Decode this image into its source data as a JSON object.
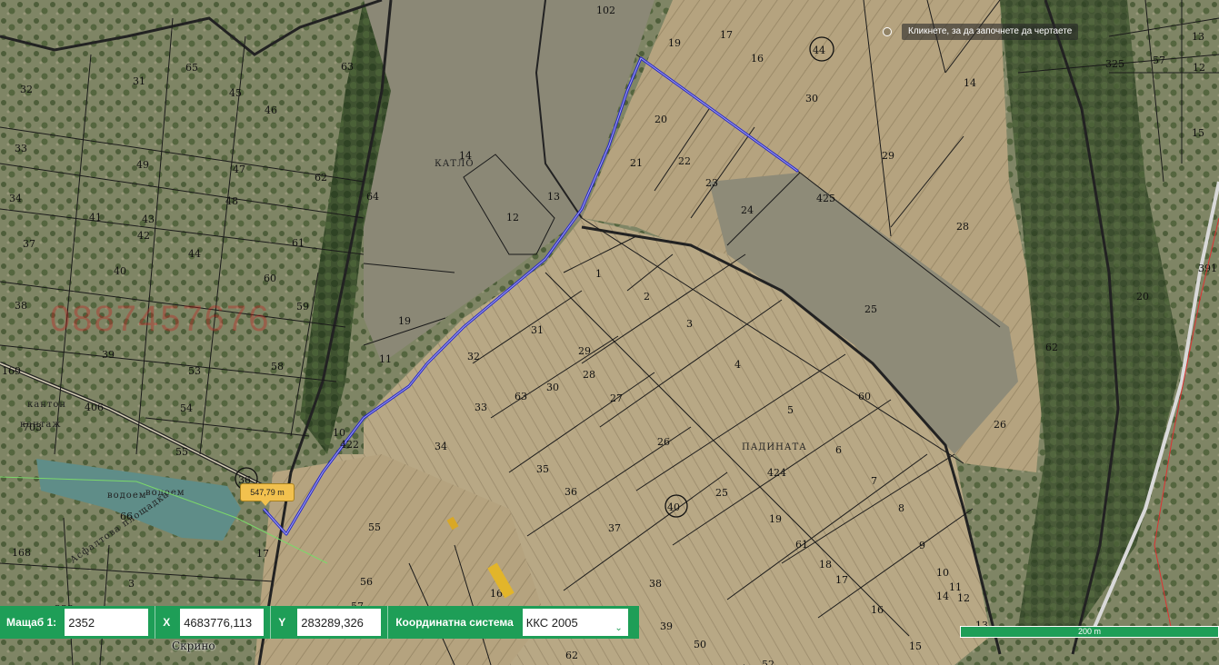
{
  "map": {
    "watermark": "0887457676",
    "hint": "Кликнете, за да започнете да чертаете",
    "measure_label": "547,79 m",
    "place_names": [
      "КАТЛО",
      "ПАДИНАТА",
      "водоем",
      "водоем",
      "Асфалтова площадка",
      "кантон",
      "кантаж"
    ],
    "town_label": "Скрино",
    "circled_labels": [
      "44",
      "36",
      "40"
    ],
    "parcel_numbers": [
      "102",
      "19",
      "17",
      "16",
      "44",
      "30",
      "20",
      "21",
      "22",
      "23",
      "24",
      "14",
      "12",
      "13",
      "29",
      "28",
      "425",
      "25",
      "26",
      "60",
      "1",
      "2",
      "3",
      "4",
      "5",
      "6",
      "7",
      "8",
      "9",
      "10",
      "11",
      "12",
      "13",
      "31",
      "32",
      "29",
      "28",
      "30",
      "27",
      "26",
      "25",
      "424",
      "19",
      "61",
      "18",
      "17",
      "16",
      "15",
      "14",
      "33",
      "63",
      "34",
      "35",
      "36",
      "37",
      "38",
      "39",
      "50",
      "51",
      "52",
      "62",
      "163",
      "55",
      "56",
      "57",
      "58",
      "59",
      "60",
      "61",
      "62",
      "63",
      "64",
      "65",
      "45",
      "46",
      "47",
      "48",
      "49",
      "43",
      "42",
      "41",
      "40",
      "39",
      "38",
      "37",
      "34",
      "33",
      "32",
      "31",
      "44",
      "53",
      "54",
      "55",
      "406",
      "703",
      "169",
      "168",
      "3",
      "66",
      "19",
      "11",
      "10",
      "422",
      "17",
      "233",
      "325",
      "13",
      "12",
      "14",
      "15",
      "20",
      "391",
      "62",
      "57"
    ]
  },
  "toolbar": {
    "scale_label": "Мащаб  1:",
    "scale_value": "2352",
    "x_label": "X",
    "x_value": "4683776,113",
    "y_label": "Y",
    "y_value": "283289,326",
    "crs_label": "Координатна система",
    "crs_value": "ККС 2005"
  },
  "scalebar": {
    "label": "200 m"
  },
  "colors": {
    "route": "#2626c8",
    "toolbar": "#1e9e57",
    "tooltip": "#f2c14e"
  }
}
